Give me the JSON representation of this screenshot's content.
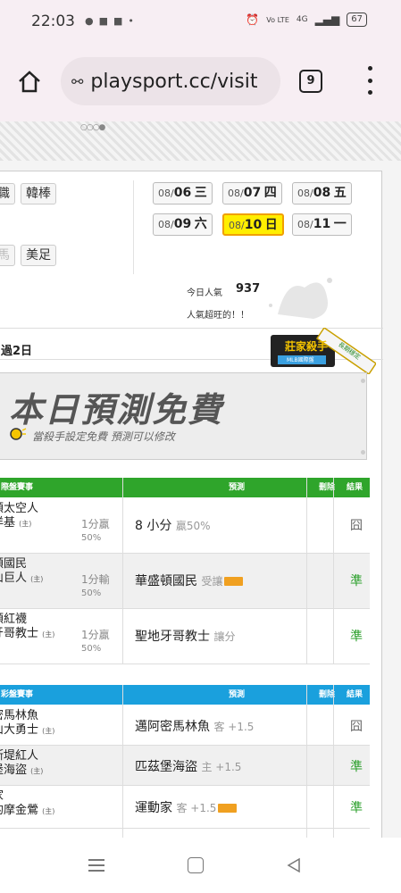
{
  "status_bar": {
    "time": "22:03",
    "battery": "67",
    "network": "4G",
    "volte": "Vo LTE"
  },
  "browser": {
    "url": "playsport.cc/visit",
    "tab_count": "9"
  },
  "sports_tabs": [
    "職",
    "韓棒",
    "馬",
    "美足"
  ],
  "dates": [
    {
      "prefix": "08/",
      "day": "06",
      "weekday": "三",
      "active": false
    },
    {
      "prefix": "08/",
      "day": "07",
      "weekday": "四",
      "active": false
    },
    {
      "prefix": "08/",
      "day": "08",
      "weekday": "五",
      "active": false
    },
    {
      "prefix": "08/",
      "day": "09",
      "weekday": "六",
      "active": false
    },
    {
      "prefix": "08/",
      "day": "10",
      "weekday": "日",
      "active": true
    },
    {
      "prefix": "08/",
      "day": "11",
      "weekday": "一",
      "active": false
    }
  ],
  "popularity": {
    "label": "今日人氣",
    "value": "937",
    "tagline": "人氣超旺的！！"
  },
  "ribbon": {
    "title": "莊家殺手",
    "subtitle": "MLB國際盤",
    "tag": "長期穩定"
  },
  "passed_label": "過2日",
  "promo": {
    "title": "本日預測免費",
    "subtitle": "當殺手設定免費 預測可以修改"
  },
  "table1": {
    "headers": {
      "game": "際盤賽事",
      "prediction": "預測",
      "delete": "刪除",
      "result": "結果"
    },
    "rows": [
      {
        "team1": "頓太空人",
        "team2": "洋基",
        "home": "(主)",
        "odds": "1分贏",
        "pct": "50%",
        "pred": "8 小分",
        "note": "贏50%",
        "badge": false,
        "result": "囧",
        "result_type": "gray"
      },
      {
        "team1": "頓國民",
        "team2": "山巨人",
        "home": "(主)",
        "odds": "1分輸",
        "pct": "50%",
        "pred": "華盛頓國民",
        "note": "受讓",
        "badge": true,
        "result": "準",
        "result_type": "win"
      },
      {
        "team1": "頓紅襪",
        "team2": "牙哥教士",
        "home": "(主)",
        "odds": "1分贏",
        "pct": "50%",
        "pred": "聖地牙哥教士",
        "note": "讓分",
        "badge": false,
        "result": "準",
        "result_type": "win"
      }
    ]
  },
  "table2": {
    "headers": {
      "game": "彩盤賽事",
      "prediction": "預測",
      "delete": "刪除",
      "result": "結果"
    },
    "rows": [
      {
        "team1": "密馬林魚",
        "team2": "山大勇士",
        "home": "(主)",
        "pred": "邁阿密馬林魚",
        "note": "客 +1.5",
        "badge": false,
        "result": "囧",
        "result_type": "gray"
      },
      {
        "team1": "斯堤紅人",
        "team2": "堡海盜",
        "home": "(主)",
        "pred": "匹茲堡海盜",
        "note": "主 +1.5",
        "badge": false,
        "result": "準",
        "result_type": "win"
      },
      {
        "team1": "家",
        "team2": "的摩金鶯",
        "home": "(主)",
        "pred": "運動家",
        "note": "客 +1.5",
        "badge": true,
        "result": "準",
        "result_type": "win"
      }
    ]
  },
  "colors": {
    "accent_green": "#2fa52b",
    "accent_blue": "#1aa0dd",
    "date_active": "#ffee00",
    "win": "#2ca02c"
  },
  "icons": [
    "home-icon",
    "tune-icon",
    "tab-switcher-icon",
    "overflow-menu-icon",
    "nav-recents-icon",
    "nav-home-icon",
    "nav-back-icon"
  ]
}
